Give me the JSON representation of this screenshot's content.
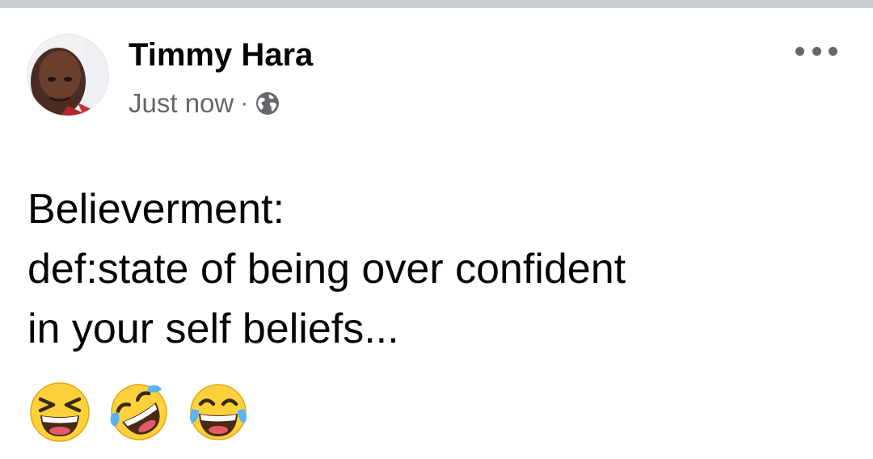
{
  "post": {
    "author": "Timmy Hara",
    "timestamp": "Just now",
    "separator": "·",
    "audience_icon": "globe-icon",
    "more_icon": "more-options-icon",
    "text_lines": [
      "Believerment:",
      "def:state of being over confident",
      "in your self beliefs..."
    ],
    "emojis": [
      "laughing-squint-emoji",
      "rolling-on-floor-laughing-emoji",
      "tears-of-joy-emoji"
    ]
  },
  "colors": {
    "divider": "#c9ccd1",
    "text_primary": "#050505",
    "text_secondary": "#65676b",
    "emoji_yellow": "#fdd13b",
    "emoji_tear": "#5bb3f0"
  }
}
